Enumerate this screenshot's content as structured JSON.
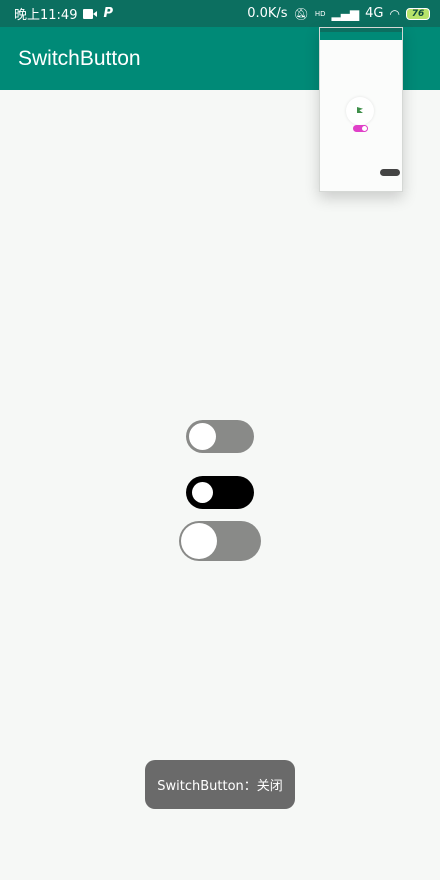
{
  "status_bar": {
    "time": "晚上11:49",
    "network_speed": "0.0K/s",
    "signal_label": "4G",
    "hd_label": "HD",
    "battery": "76",
    "icons": [
      "video-camera-icon",
      "p-icon",
      "mute-icon",
      "signal-icon",
      "wifi-icon",
      "battery-icon"
    ]
  },
  "app_bar": {
    "title": "SwitchButton",
    "color": "#008a77"
  },
  "switches": [
    {
      "state": "off",
      "track_color": "#898a88"
    },
    {
      "state": "off",
      "track_color": "#000000"
    },
    {
      "state": "off",
      "track_color": "#898a88"
    }
  ],
  "toast": {
    "text": "SwitchButton：关闭"
  },
  "colors": {
    "status_bar": "#0c6f60",
    "background": "#f6f8f6",
    "preview_switch": "#e040c8"
  }
}
